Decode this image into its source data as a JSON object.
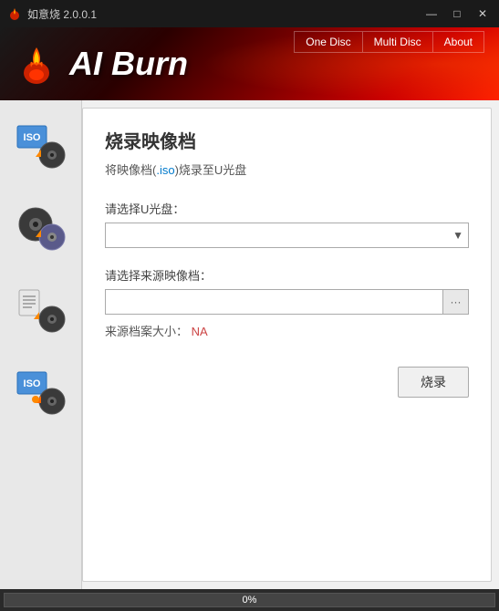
{
  "window": {
    "title": "如意烧 2.0.0.1",
    "icon": "flame"
  },
  "titleBar": {
    "title": "如意烧 2.0.0.1",
    "minimizeLabel": "—",
    "maximizeLabel": "□",
    "closeLabel": "✕"
  },
  "header": {
    "appTitle": "AI Burn",
    "nav": {
      "oneDisc": "One Disc",
      "multiDisc": "Multi Disc",
      "about": "About"
    }
  },
  "content": {
    "sectionTitle": "烧录映像档",
    "subtitle_pre": "将映像档(",
    "subtitle_iso": ".iso",
    "subtitle_post": ")烧录至U光盘",
    "uDiscLabel": "请选择U光盘：",
    "sourceLabel": "请选择来源映像档：",
    "fileSizeLabel": "来源档案大小：",
    "fileSizeValue": "NA",
    "burnButtonLabel": "烧录"
  },
  "progressBar": {
    "percent": "0%",
    "fill": 0
  },
  "sidebar": {
    "items": [
      {
        "name": "iso-to-udisc",
        "tooltip": "ISO to U disc"
      },
      {
        "name": "disc-clone",
        "tooltip": "Disc clone"
      },
      {
        "name": "file-burn",
        "tooltip": "File burn"
      },
      {
        "name": "iso-burn",
        "tooltip": "ISO burn to USB"
      }
    ]
  }
}
